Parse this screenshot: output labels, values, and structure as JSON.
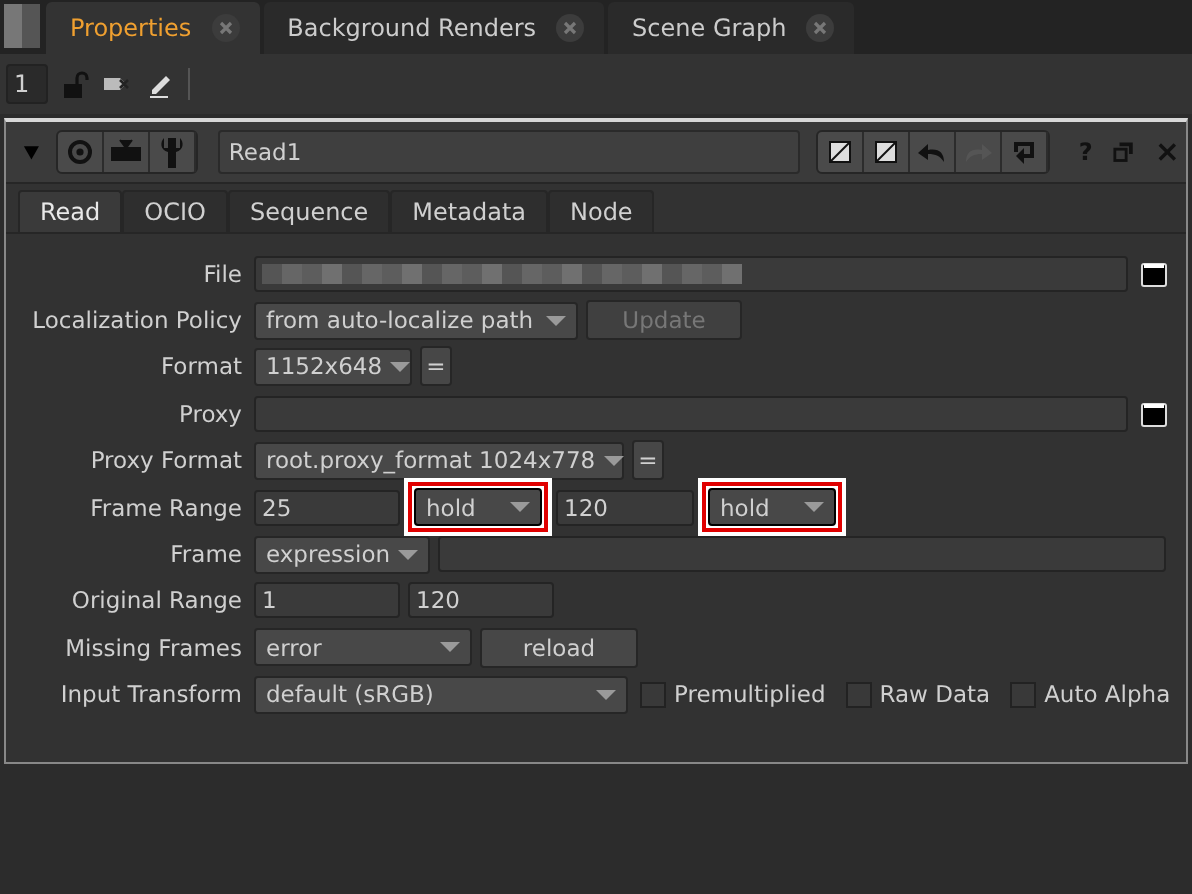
{
  "panel_tabs": [
    {
      "label": "Properties",
      "selected": true
    },
    {
      "label": "Background Renders",
      "selected": false
    },
    {
      "label": "Scene Graph",
      "selected": false
    }
  ],
  "toolbar": {
    "count": "1"
  },
  "node": {
    "expanded": true,
    "name": "Read1"
  },
  "help": "?",
  "tabs": [
    {
      "label": "Read",
      "selected": true
    },
    {
      "label": "OCIO",
      "selected": false
    },
    {
      "label": "Sequence",
      "selected": false
    },
    {
      "label": "Metadata",
      "selected": false
    },
    {
      "label": "Node",
      "selected": false
    }
  ],
  "rows": [
    {
      "label": "File",
      "controls": [
        {
          "kind": "blurred-field"
        },
        {
          "kind": "folder"
        }
      ]
    },
    {
      "label": "Localization Policy",
      "controls": [
        {
          "kind": "dropdown",
          "value": "from auto-localize path",
          "highlighted": false
        },
        {
          "kind": "button",
          "label": "Update",
          "disabled": true
        }
      ]
    },
    {
      "label": "Format",
      "controls": [
        {
          "kind": "dropdown",
          "value": "1152x648",
          "highlighted": false
        },
        {
          "kind": "button",
          "label": "=",
          "disabled": false
        }
      ]
    },
    {
      "label": "Proxy",
      "controls": [
        {
          "kind": "field"
        },
        {
          "kind": "folder"
        }
      ]
    },
    {
      "label": "Proxy Format",
      "controls": [
        {
          "kind": "dropdown",
          "value": "root.proxy_format 1024x778",
          "highlighted": false
        },
        {
          "kind": "button",
          "label": "=",
          "disabled": false
        }
      ]
    },
    {
      "label": "Frame Range",
      "controls": [
        {
          "kind": "field",
          "value": "25"
        },
        {
          "kind": "dropdown",
          "value": "hold",
          "highlighted": true
        },
        {
          "kind": "field",
          "value": "120"
        },
        {
          "kind": "dropdown",
          "value": "hold",
          "highlighted": true
        }
      ]
    },
    {
      "label": "Frame",
      "controls": [
        {
          "kind": "dropdown",
          "value": "expression",
          "highlighted": false
        },
        {
          "kind": "field"
        }
      ]
    },
    {
      "label": "Original Range",
      "controls": [
        {
          "kind": "field",
          "value": "1"
        },
        {
          "kind": "field",
          "value": "120"
        }
      ]
    },
    {
      "label": "Missing Frames",
      "controls": [
        {
          "kind": "dropdown",
          "value": "error",
          "highlighted": false
        },
        {
          "kind": "button",
          "label": "reload",
          "disabled": false
        }
      ]
    },
    {
      "label": "Input Transform",
      "controls": [
        {
          "kind": "dropdown",
          "value": "default (sRGB)",
          "highlighted": false
        },
        {
          "kind": "checkbox",
          "label": "Premultiplied",
          "checked": false
        },
        {
          "kind": "checkbox",
          "label": "Raw Data",
          "checked": false
        },
        {
          "kind": "checkbox",
          "label": "Auto Alpha",
          "checked": false
        }
      ]
    }
  ]
}
